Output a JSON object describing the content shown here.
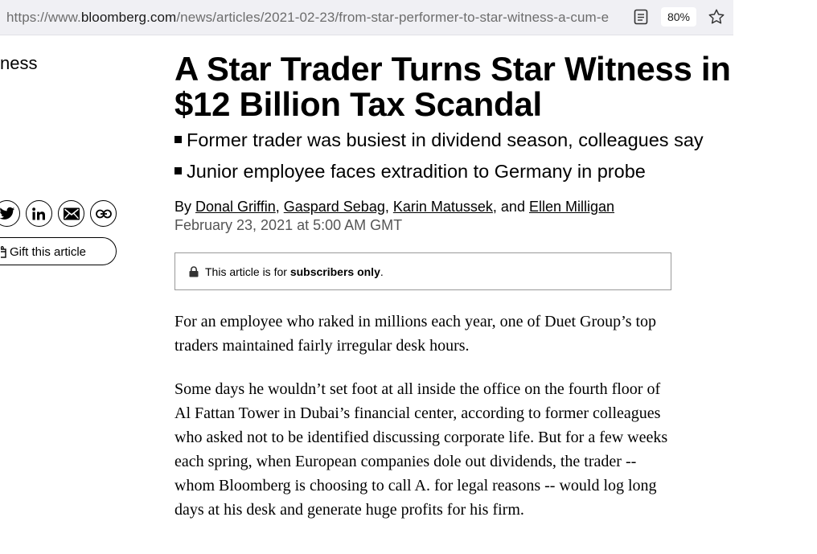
{
  "browser": {
    "url_prefix": "https://www.",
    "url_host": "bloomberg.com",
    "url_path": "/news/articles/2021-02-23/from-star-performer-to-star-witness-a-cum-e",
    "zoom": "80%"
  },
  "rail": {
    "section_label": "ness",
    "gift_label": "Gift this article"
  },
  "article": {
    "headline": "A Star Trader Turns Star Witness in $12 Billion Tax Scandal",
    "bullets": [
      "Former trader was busiest in dividend season, colleagues say",
      "Junior employee faces extradition to Germany in probe"
    ],
    "byline": {
      "by": "By ",
      "authors": [
        "Donal Griffin",
        "Gaspard Sebag",
        "Karin Matussek",
        "Ellen Milligan"
      ],
      "sep1": ", ",
      "sep2": ", ",
      "sep3": ", and "
    },
    "date": "February 23, 2021 at 5:00 AM GMT",
    "paywall": {
      "prefix": "This article is for ",
      "bold": "subscribers only",
      "suffix": "."
    },
    "paragraphs": [
      "For an employee who raked in millions each year, one of Duet Group’s top traders maintained fairly irregular desk hours.",
      "Some days he wouldn’t set foot at all inside the office on the fourth floor of Al Fattan Tower in Dubai’s financial center, according to former colleagues who asked not to be identified discussing corporate life. But for a few weeks each spring, when European companies dole out dividends, the trader -- whom Bloomberg is choosing to call A. for legal reasons -- would log long days at his desk and generate huge profits for his firm."
    ]
  }
}
